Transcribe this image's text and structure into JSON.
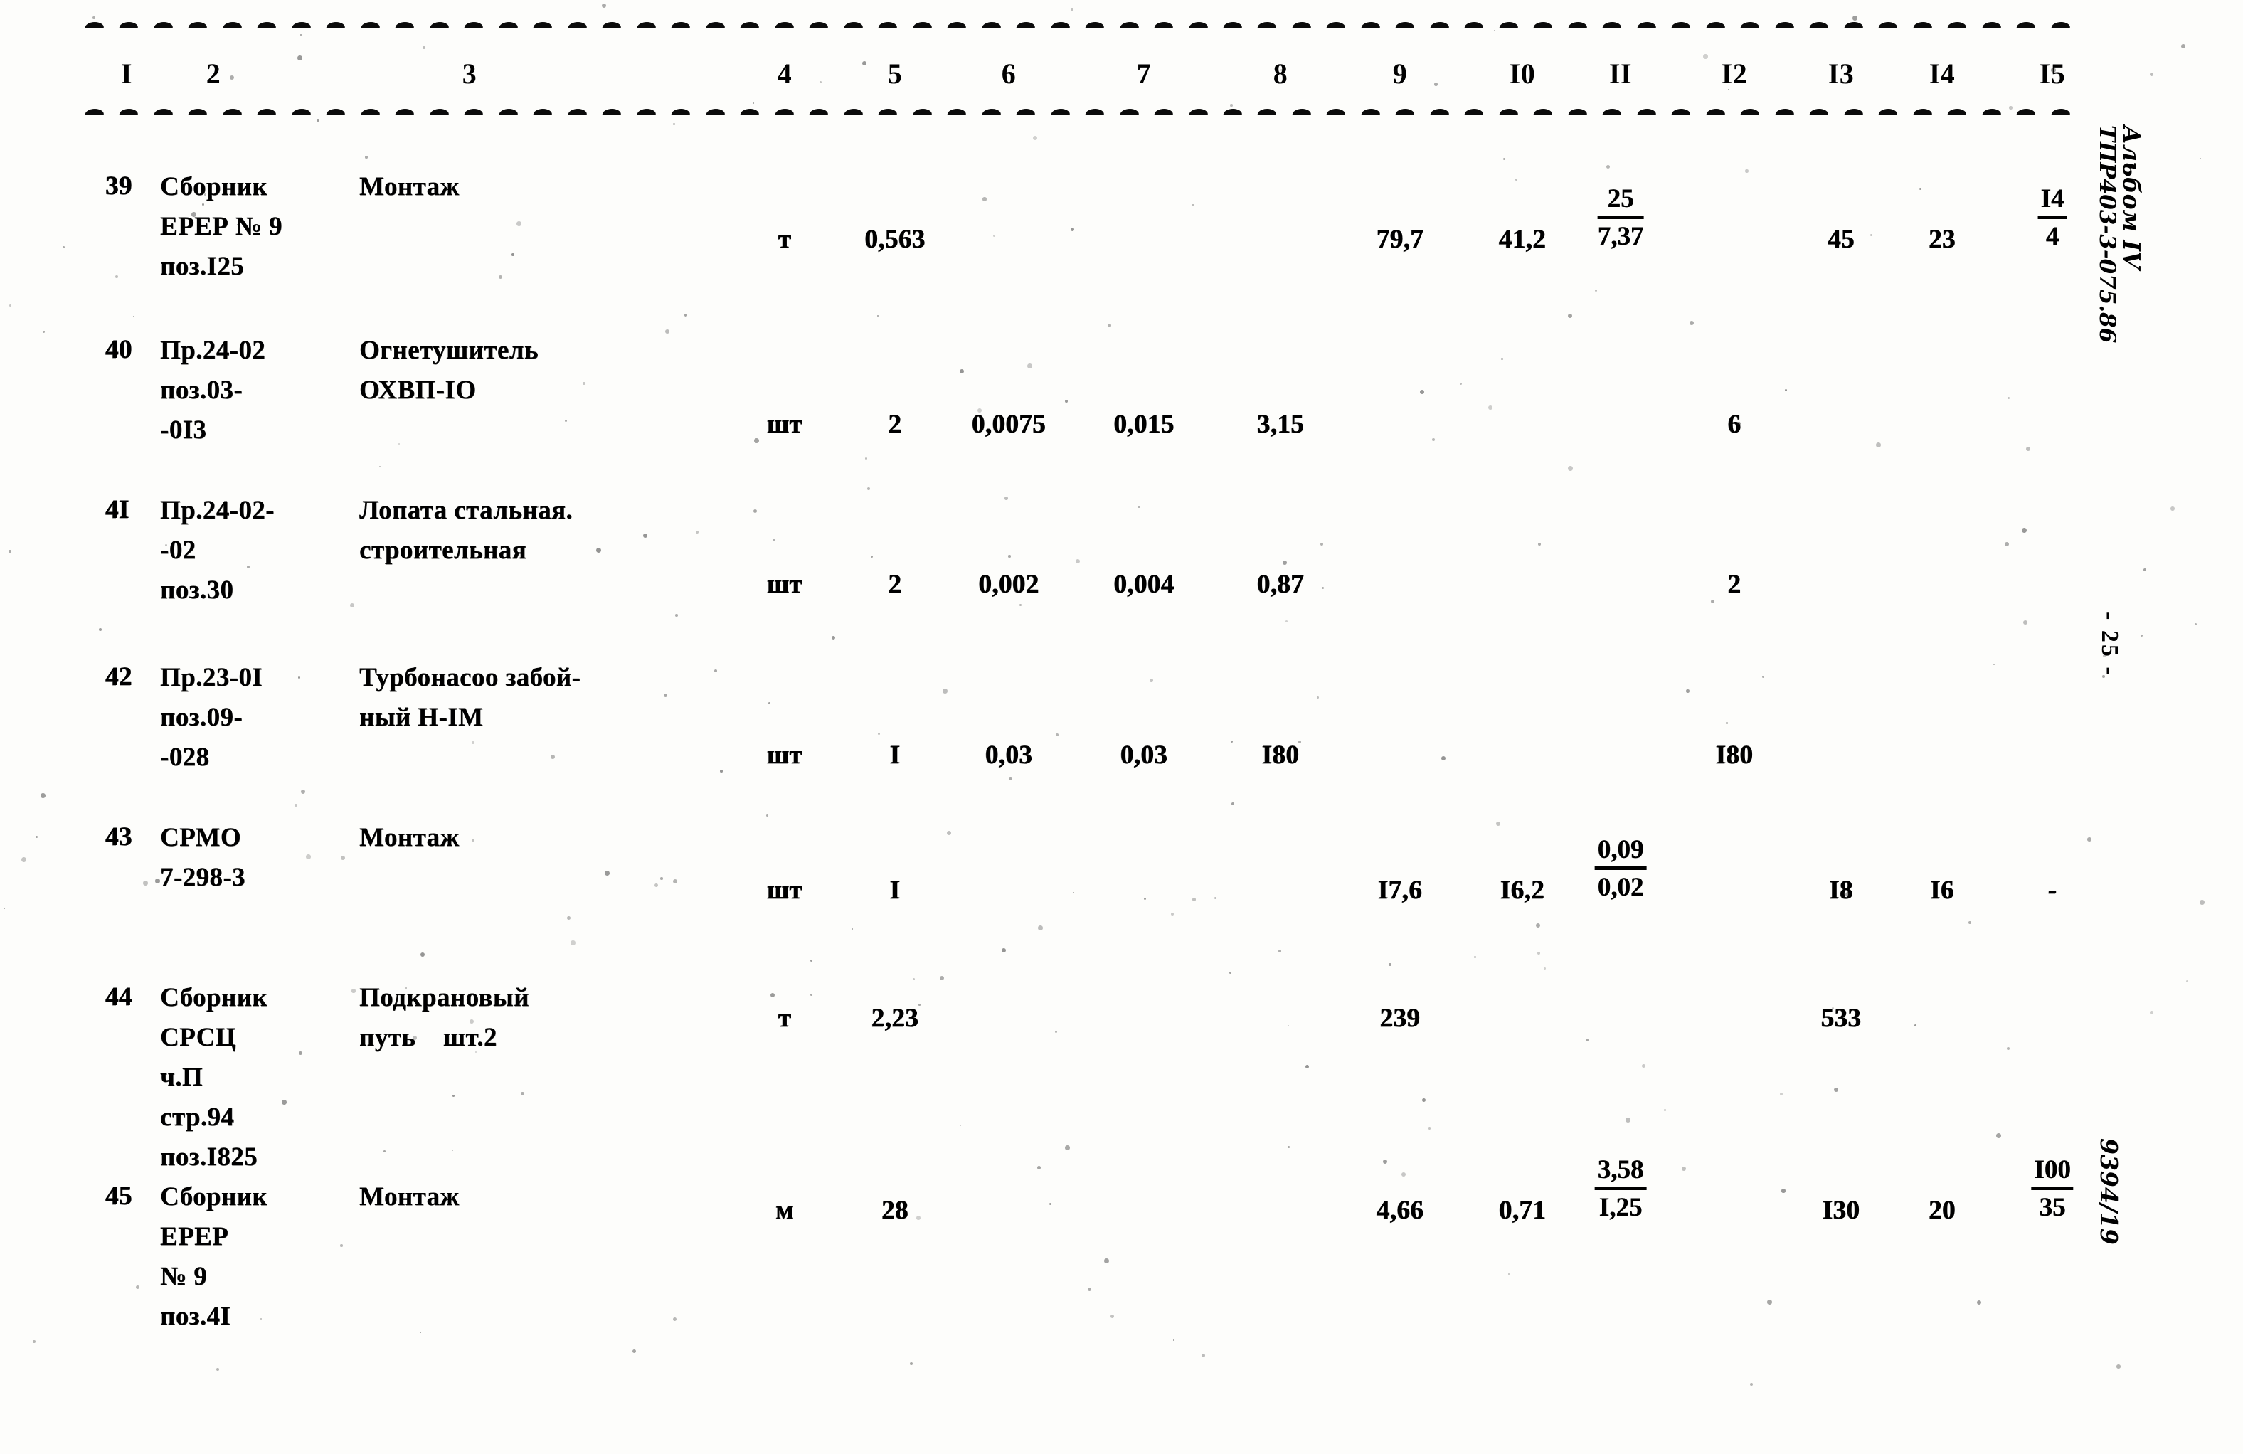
{
  "document": {
    "type": "soviet-estimate-table",
    "ink_color": "#0b0b0b",
    "paper_color": "#fdfdfb"
  },
  "header": {
    "columns": [
      "I",
      "2",
      "3",
      "4",
      "5",
      "6",
      "7",
      "8",
      "9",
      "I0",
      "II",
      "I2",
      "I3",
      "I4",
      "I5"
    ]
  },
  "margin": {
    "album_line1": "Альбом IV",
    "album_line2": "ТПР403-3-075.86",
    "page_number": "- 25 -",
    "doc_code": "9394/19"
  },
  "rows": [
    {
      "num": "39",
      "code": "Сборник\nЕРЕР № 9\nпоз.I25",
      "name": "Монтаж",
      "unit": "т",
      "c5": "0,563",
      "c6": "",
      "c7": "",
      "c8": "",
      "c9": "79,7",
      "c10": "41,2",
      "c11": {
        "num": "25",
        "den": "7,37"
      },
      "c12": "",
      "c13": "45",
      "c14": "23",
      "c15": {
        "num": "I4",
        "den": "4"
      }
    },
    {
      "num": "40",
      "code": "Пр.24-02\nпоз.03-\n-0I3",
      "name": "Огнетушитель\nОХВП-IО",
      "unit": "шт",
      "c5": "2",
      "c6": "0,0075",
      "c7": "0,015",
      "c8": "3,15",
      "c9": "",
      "c10": "",
      "c11": "",
      "c12": "6",
      "c13": "",
      "c14": "",
      "c15": ""
    },
    {
      "num": "4I",
      "code": "Пр.24-02-\n-02\nпоз.30",
      "name": "Лопата стальная.\nстроительная",
      "unit": "шт",
      "c5": "2",
      "c6": "0,002",
      "c7": "0,004",
      "c8": "0,87",
      "c9": "",
      "c10": "",
      "c11": "",
      "c12": "2",
      "c13": "",
      "c14": "",
      "c15": ""
    },
    {
      "num": "42",
      "code": "Пр.23-0I\nпоз.09-\n-028",
      "name": "Турбонасоо забой-\nный Н-IМ",
      "unit": "шт",
      "c5": "I",
      "c6": "0,03",
      "c7": "0,03",
      "c8": "I80",
      "c9": "",
      "c10": "",
      "c11": "",
      "c12": "I80",
      "c13": "",
      "c14": "",
      "c15": ""
    },
    {
      "num": "43",
      "code": "СРМО\n7-298-3",
      "name": "Монтаж",
      "unit": "шт",
      "c5": "I",
      "c6": "",
      "c7": "",
      "c8": "",
      "c9": "I7,6",
      "c10": "I6,2",
      "c11": {
        "num": "0,09",
        "den": "0,02"
      },
      "c12": "",
      "c13": "I8",
      "c14": "I6",
      "c15": "-"
    },
    {
      "num": "44",
      "code": "Сборник\nСРСЦ\nч.П\nстр.94\nпоз.I825",
      "name": "Подкрановый\nпуть    шт.2",
      "unit": "т",
      "c5": "2,23",
      "c6": "",
      "c7": "",
      "c8": "",
      "c9": "239",
      "c10": "",
      "c11": "",
      "c12": "",
      "c13": "533",
      "c14": "",
      "c15": ""
    },
    {
      "num": "45",
      "code": "Сборник\nЕРЕР\n№ 9\nпоз.4I",
      "name": "Монтаж",
      "unit": "м",
      "c5": "28",
      "c6": "",
      "c7": "",
      "c8": "",
      "c9": "4,66",
      "c10": "0,71",
      "c11": {
        "num": "3,58",
        "den": "I,25"
      },
      "c12": "",
      "c13": "I30",
      "c14": "20",
      "c15": {
        "num": "I00",
        "den": "35"
      }
    }
  ]
}
